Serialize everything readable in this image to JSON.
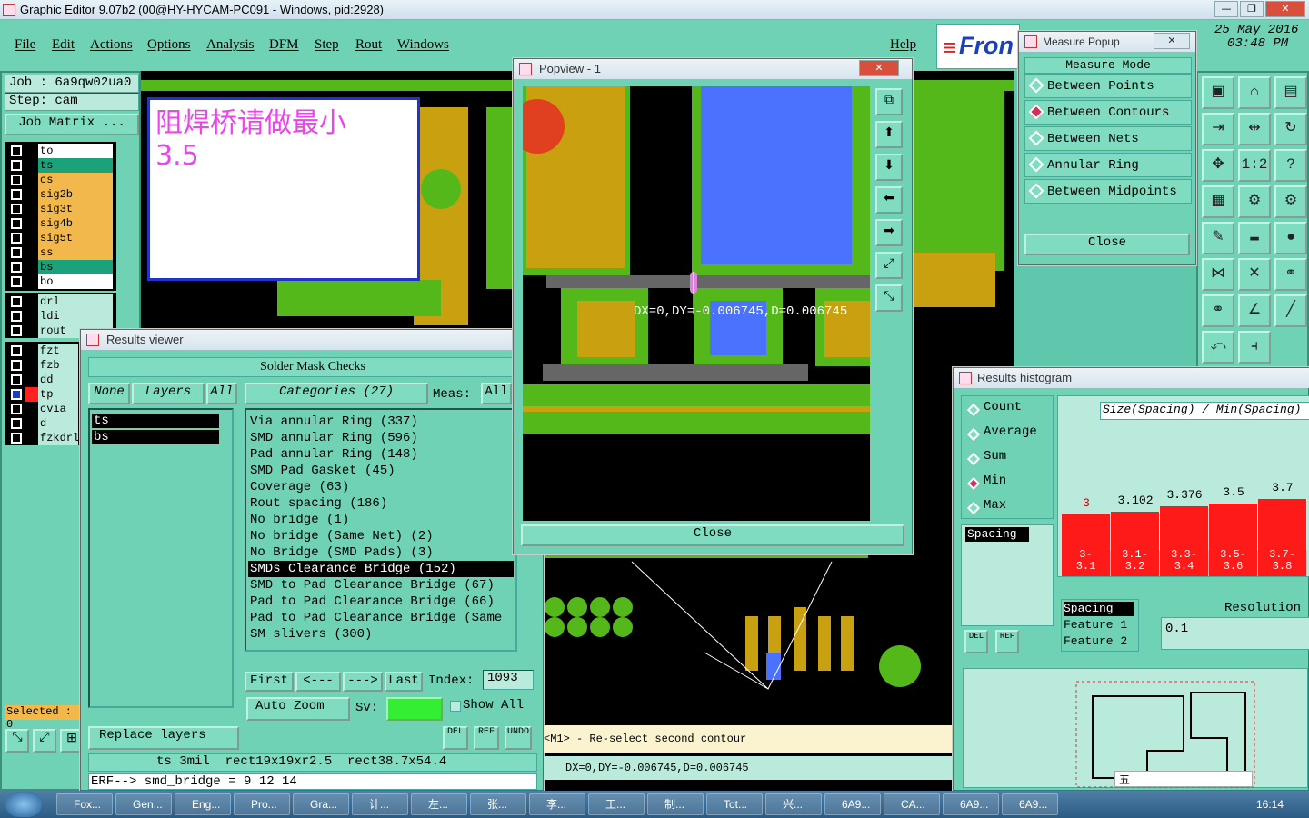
{
  "window": {
    "title": "Graphic Editor 9.07b2 (00@HY-HYCAM-PC091 - Windows, pid:2928)"
  },
  "menu": {
    "items": [
      "File",
      "Edit",
      "Actions",
      "Options",
      "Analysis",
      "DFM",
      "Step",
      "Rout",
      "Windows"
    ],
    "help": "Help"
  },
  "brand": {
    "logo": "Fron",
    "date": "25 May 2016",
    "time": "03:48 PM"
  },
  "job": {
    "job_label": "Job : 6a9qw02ua0",
    "step_label": "Step: cam",
    "matrix_btn": "Job Matrix ..."
  },
  "note": {
    "text": "阻焊桥请做最小3.5"
  },
  "layers": {
    "group1": [
      {
        "name": "to",
        "color": "#ffffff"
      },
      {
        "name": "ts",
        "color": "#1aa37a"
      },
      {
        "name": "cs",
        "color": "#f2b84b"
      },
      {
        "name": "sig2b",
        "color": "#f2b84b"
      },
      {
        "name": "sig3t",
        "color": "#f2b84b"
      },
      {
        "name": "sig4b",
        "color": "#f2b84b"
      },
      {
        "name": "sig5t",
        "color": "#f2b84b"
      },
      {
        "name": "ss",
        "color": "#f2b84b"
      },
      {
        "name": "bs",
        "color": "#1aa37a"
      },
      {
        "name": "bo",
        "color": "#ffffff"
      }
    ],
    "group2": [
      {
        "name": "drl"
      },
      {
        "name": "ldi"
      },
      {
        "name": "rout"
      }
    ],
    "group3": [
      {
        "name": "fzt"
      },
      {
        "name": "fzb"
      },
      {
        "name": "dd"
      },
      {
        "name": "tp"
      },
      {
        "name": "cvia"
      },
      {
        "name": "d"
      },
      {
        "name": "fzkdrl"
      }
    ],
    "selected": "Selected : 0"
  },
  "results": {
    "title": "Results viewer",
    "header": "Solder Mask Checks",
    "none": "None",
    "layers": "Layers",
    "all": "All",
    "categories": "Categories (27)",
    "meas": "Meas:",
    "meas_all": "All",
    "layer_list": [
      "ts",
      "bs"
    ],
    "items": [
      "Via annular Ring (337)",
      "SMD annular Ring (596)",
      "Pad annular Ring (148)",
      "SMD Pad Gasket (45)",
      "Coverage (63)",
      "Rout spacing (186)",
      "No bridge (1)",
      "No bridge (Same Net) (2)",
      "No Bridge (SMD Pads) (3)",
      "SMDs Clearance Bridge (152)",
      "SMD to Pad Clearance Bridge (67)",
      "Pad to Pad Clearance Bridge (66)",
      "Pad to Pad Clearance Bridge (Same",
      "SM slivers (300)"
    ],
    "selected_index": 9,
    "first": "First",
    "prev": "<---",
    "next": "--->",
    "last": "Last",
    "index_label": "Index:",
    "index_value": "1093",
    "auto_zoom": "Auto Zoom",
    "sv": "Sv:",
    "show_all": "Show All",
    "replace": "Replace layers",
    "del": "DEL",
    "ref": "REF",
    "undo": "UNDO",
    "status1": "ts 3mil  rect19x19xr2.5  rect38.7x54.4",
    "status2": "ERF--> smd_bridge = 9 12 14"
  },
  "popview": {
    "title": "Popview - 1",
    "measure": "DX=0,DY=-0.006745,D=0.006745",
    "close": "Close"
  },
  "prompt": {
    "text": "<M1> - Re-select second contour",
    "readout": "DX=0,DY=-0.006745,D=0.006745"
  },
  "measure": {
    "title": "Measure Popup",
    "mode": "Measure Mode",
    "options": [
      "Between Points",
      "Between Contours",
      "Between Nets",
      "Annular Ring",
      "Between Midpoints"
    ],
    "selected": 1,
    "close": "Close"
  },
  "histogram": {
    "title": "Results histogram",
    "stats": [
      "Count",
      "Average",
      "Sum",
      "Min",
      "Max"
    ],
    "selected_stat": 3,
    "axis_title": "Size(Spacing) / Min(Spacing)",
    "bars": [
      {
        "label": "3",
        "value": 3
      },
      {
        "label": "3.102",
        "value": 3.102
      },
      {
        "label": "3.376",
        "value": 3.376
      },
      {
        "label": "3.5",
        "value": 3.5
      },
      {
        "label": "3.7",
        "value": 3.7
      }
    ],
    "ranges": [
      "3-\n3.1",
      "3.1-\n3.2",
      "3.3-\n3.4",
      "3.5-\n3.6",
      "3.7-\n3.8"
    ],
    "spacing_list": [
      "Spacing"
    ],
    "spacing_items": [
      "Spacing",
      "Feature 1",
      "Feature 2"
    ],
    "resolution_label": "Resolution",
    "resolution": "0.1",
    "del": "DEL",
    "ref": "REF"
  },
  "taskbar": {
    "items": [
      "Fox...",
      "Gen...",
      "Eng...",
      "Pro...",
      "Gra...",
      "计...",
      "左...",
      "张...",
      "李...",
      "工...",
      "制...",
      "Tot...",
      "兴...",
      "6A9...",
      "CA...",
      "6A9...",
      "6A9..."
    ],
    "ime": "五",
    "clock": "16:14"
  },
  "colors": {
    "panel": "#6fd2b5",
    "canvas": "#000000",
    "copper": "#c9a010",
    "mask": "#55b81a",
    "blue": "#4a72ff",
    "red": "#ff1a1a"
  }
}
